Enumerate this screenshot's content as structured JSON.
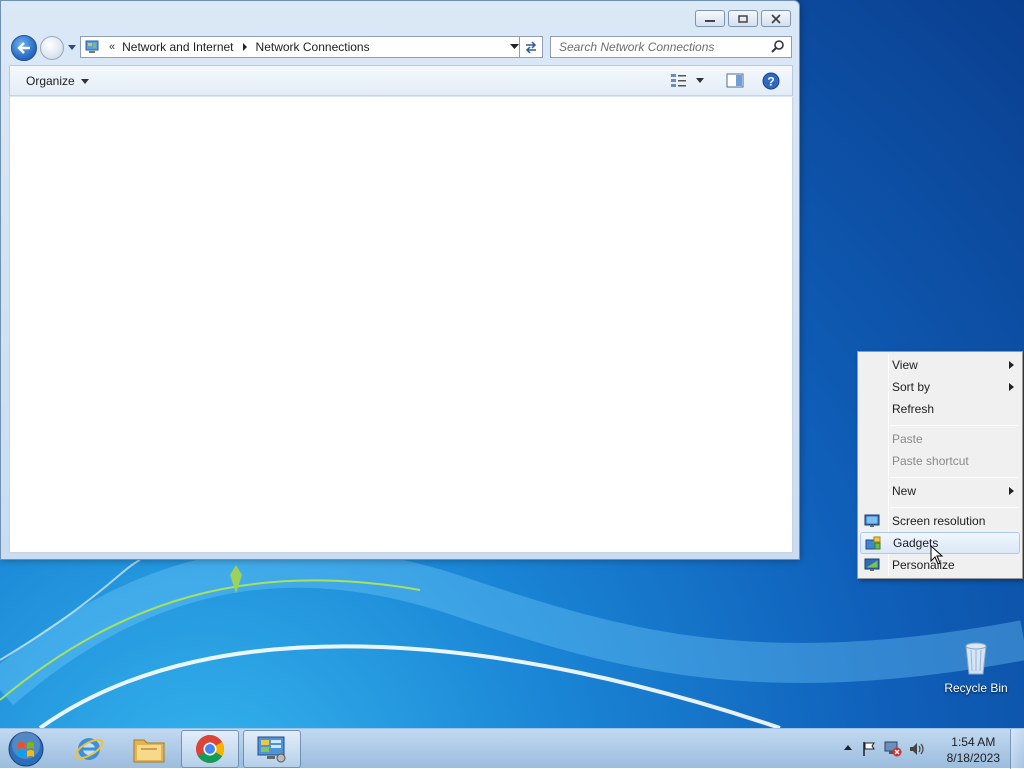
{
  "window": {
    "breadcrumb_sep": "«",
    "crumbs": [
      "Network and Internet",
      "Network Connections"
    ],
    "search_placeholder": "Search Network Connections",
    "organize_label": "Organize"
  },
  "context_menu": {
    "items": [
      {
        "label": "View",
        "submenu": true,
        "enabled": true
      },
      {
        "label": "Sort by",
        "submenu": true,
        "enabled": true
      },
      {
        "label": "Refresh",
        "submenu": false,
        "enabled": true
      },
      {
        "label": "Paste",
        "submenu": false,
        "enabled": false
      },
      {
        "label": "Paste shortcut",
        "submenu": false,
        "enabled": false
      },
      {
        "label": "New",
        "submenu": true,
        "enabled": true
      },
      {
        "label": "Screen resolution",
        "icon": "monitor-icon",
        "enabled": true
      },
      {
        "label": "Gadgets",
        "icon": "gadgets-icon",
        "enabled": true,
        "hovered": true
      },
      {
        "label": "Personalize",
        "icon": "personalize-icon",
        "enabled": true
      }
    ]
  },
  "desktop": {
    "recycle_bin_label": "Recycle Bin"
  },
  "taskbar": {
    "apps": [
      "internet-explorer-icon",
      "file-explorer-icon",
      "chrome-icon",
      "network-connections-icon"
    ],
    "clock_time": "1:54 AM",
    "clock_date": "8/18/2023"
  }
}
